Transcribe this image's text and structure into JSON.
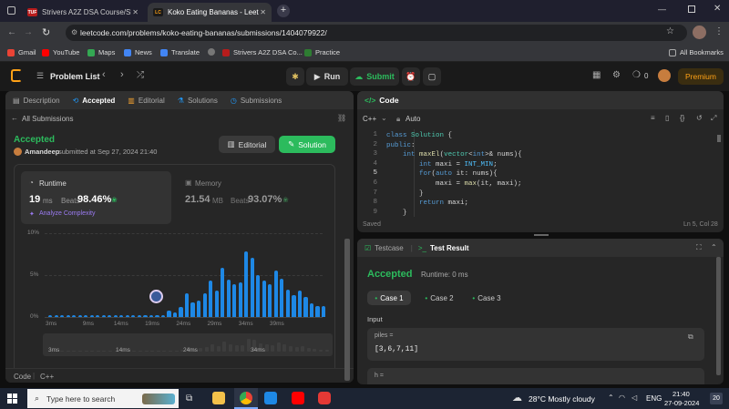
{
  "browser": {
    "tabs": [
      {
        "favicon": "TUF",
        "title": "Strivers A2Z DSA Course/Sheet"
      },
      {
        "favicon": "LC",
        "title": "Koko Eating Bananas - LeetCod"
      }
    ],
    "url": "leetcode.com/problems/koko-eating-bananas/submissions/1404079922/",
    "bookmarks": [
      "Gmail",
      "YouTube",
      "Maps",
      "News",
      "Translate",
      "Strivers A2Z DSA Co...",
      "Practice"
    ],
    "all_bookmarks": "All Bookmarks"
  },
  "lc_top": {
    "problem_list": "Problem List",
    "run": "Run",
    "submit": "Submit",
    "points": "0",
    "premium": "Premium"
  },
  "left_panel": {
    "tabs": [
      "Description",
      "Accepted",
      "Editorial",
      "Solutions",
      "Submissions"
    ],
    "back_label": "All Submissions",
    "status": "Accepted",
    "author": "Amandeep",
    "submitted_text": "submitted at Sep 27, 2024 21:40",
    "editorial_btn": "Editorial",
    "solution_btn": "Solution",
    "runtime_label": "Runtime",
    "runtime_value": "19",
    "runtime_unit": "ms",
    "beats_label": "Beats",
    "runtime_beats": "98.46%",
    "analyze": "Analyze Complexity",
    "memory_label": "Memory",
    "memory_value": "21.54",
    "memory_unit": "MB",
    "memory_beats": "93.07%",
    "code_label": "Code",
    "lang_label": "C++"
  },
  "chart_data": {
    "type": "bar",
    "y_ticks": [
      "10%",
      "5%",
      "0%"
    ],
    "x_ticks": [
      "3ms",
      "9ms",
      "14ms",
      "19ms",
      "24ms",
      "29ms",
      "34ms",
      "39ms"
    ],
    "mini_x_ticks": [
      "3ms",
      "14ms",
      "24ms",
      "34ms"
    ],
    "ylim": [
      0,
      10
    ],
    "values": [
      0.2,
      0.2,
      0.2,
      0.2,
      0.2,
      0.2,
      0.2,
      0.2,
      0.2,
      0.2,
      0.2,
      0.2,
      0.2,
      0.2,
      0.2,
      0.2,
      0.2,
      0.2,
      0.2,
      0.2,
      0.8,
      0.5,
      1.2,
      2.8,
      1.7,
      2.0,
      2.8,
      4.3,
      3.1,
      5.9,
      4.5,
      3.9,
      4.1,
      7.8,
      7.1,
      5.0,
      4.3,
      3.9,
      5.5,
      4.6,
      3.3,
      2.6,
      3.1,
      2.4,
      1.6,
      1.3,
      1.3
    ],
    "highlight_x": "19ms"
  },
  "editor": {
    "title": "Code",
    "lang": "C++",
    "mode": "Auto",
    "lines": [
      "class Solution {",
      "public:",
      "    int maxEl(vector<int>& nums){",
      "        int maxi = INT_MIN;",
      "        for(auto it: nums){",
      "            maxi = max(it, maxi);",
      "        }",
      "        return maxi;",
      "    }"
    ],
    "line_numbers": [
      "1",
      "2",
      "3",
      "4",
      "5",
      "6",
      "7",
      "8",
      "9"
    ],
    "saved": "Saved",
    "cursor": "Ln 5, Col 28"
  },
  "result_panel": {
    "tabs": [
      "Testcase",
      "Test Result"
    ],
    "status": "Accepted",
    "runtime": "Runtime: 0 ms",
    "cases": [
      "Case 1",
      "Case 2",
      "Case 3"
    ],
    "input_label": "Input",
    "var1_name": "piles =",
    "var1_value": "[3,6,7,11]",
    "var2_name": "h ="
  },
  "taskbar": {
    "search_placeholder": "Type here to search",
    "weather": "28°C  Mostly cloudy",
    "lang": "ENG",
    "time": "21:40",
    "date": "27-09-2024",
    "notif": "20"
  }
}
